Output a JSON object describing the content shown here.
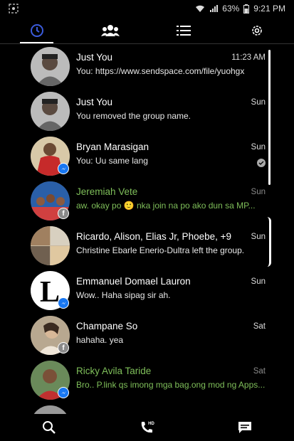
{
  "status": {
    "battery": "63%",
    "time": "9:21 PM"
  },
  "tabs": [
    {
      "name": "recent"
    },
    {
      "name": "groups"
    },
    {
      "name": "list"
    },
    {
      "name": "settings"
    }
  ],
  "conversations": [
    {
      "name": "Just You",
      "preview": "You: https://www.sendspace.com/file/yuohgx",
      "time": "11:23 AM",
      "badge": ""
    },
    {
      "name": "Just You",
      "preview": "You removed the group name.",
      "time": "Sun",
      "badge": ""
    },
    {
      "name": "Bryan Marasigan",
      "preview": "You: Uu same lang",
      "time": "Sun",
      "badge": "msg"
    },
    {
      "name": "Jeremiah Vete",
      "preview": "aw. okay po 🙂 nka join na po ako dun sa MP...",
      "time": "Sun",
      "badge": "fb"
    },
    {
      "name": "Ricardo, Alison, Elias Jr, Phoebe, +9",
      "preview": "Christine Ebarle Enerio-Dultra left the group.",
      "time": "Sun",
      "badge": ""
    },
    {
      "name": "Emmanuel Domael Lauron",
      "preview": "Wow.. Haha sipag sir ah.",
      "time": "Sun",
      "badge": "msg"
    },
    {
      "name": "Champane So",
      "preview": "hahaha.  yea",
      "time": "Sat",
      "badge": "fb"
    },
    {
      "name": "Ricky Avila Taride",
      "preview": "Bro.. P.link qs imong mga bag.ong mod ng Apps...",
      "time": "Sat",
      "badge": "msg"
    }
  ],
  "bottom": {
    "phone_hd": "HD"
  }
}
